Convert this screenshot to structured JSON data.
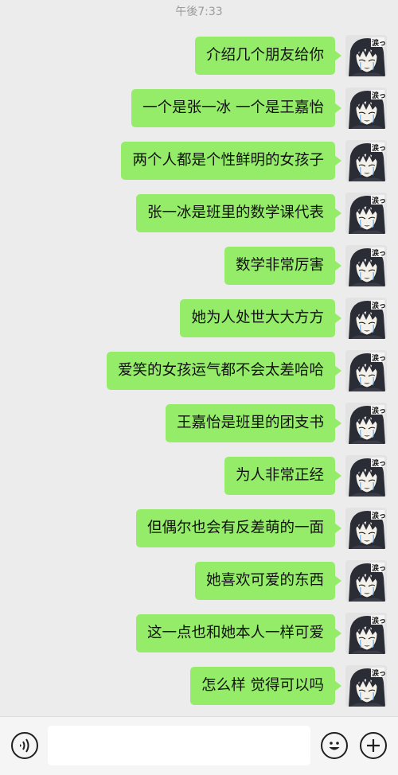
{
  "chat": {
    "timestamp": "午後7:33",
    "messages": [
      {
        "text": "介绍几个朋友给你"
      },
      {
        "text": "一个是张一冰 一个是王嘉怡"
      },
      {
        "text": "两个人都是个性鲜明的女孩子"
      },
      {
        "text": "张一冰是班里的数学课代表"
      },
      {
        "text": "数学非常厉害"
      },
      {
        "text": "她为人处世大大方方"
      },
      {
        "text": "爱笑的女孩运气都不会太差哈哈"
      },
      {
        "text": "王嘉怡是班里的团支书"
      },
      {
        "text": "为人非常正经"
      },
      {
        "text": "但偶尔也会有反差萌的一面"
      },
      {
        "text": "她喜欢可爱的东西"
      },
      {
        "text": "这一点也和她本人一样可爱"
      },
      {
        "text": "怎么样 觉得可以吗"
      }
    ],
    "avatar_label": "涙っ"
  },
  "input_bar": {
    "voice_icon": "voice-icon",
    "text_value": "",
    "emoji_icon": "emoji-icon",
    "plus_icon": "plus-icon"
  },
  "colors": {
    "bubble": "#95ec69",
    "background": "#ececec"
  }
}
